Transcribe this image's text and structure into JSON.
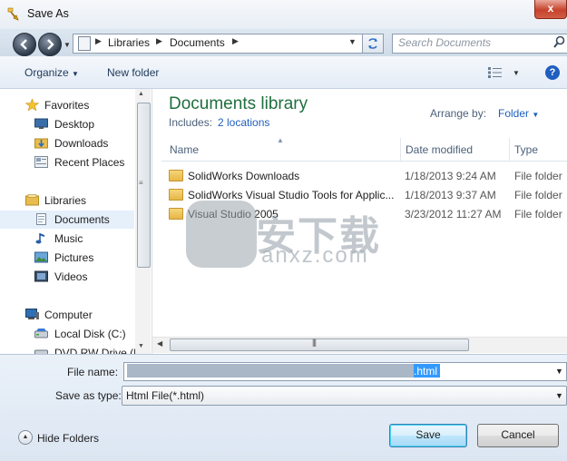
{
  "window": {
    "title": "Save As",
    "close_label": "x"
  },
  "address": {
    "crumbs": [
      "Libraries",
      "Documents"
    ],
    "search_placeholder": "Search Documents"
  },
  "toolbar": {
    "organize": "Organize",
    "new_folder": "New folder"
  },
  "nav": {
    "favorites": "Favorites",
    "desktop": "Desktop",
    "downloads": "Downloads",
    "recent": "Recent Places",
    "libraries": "Libraries",
    "documents": "Documents",
    "music": "Music",
    "pictures": "Pictures",
    "videos": "Videos",
    "computer": "Computer",
    "local_disk": "Local Disk (C:)",
    "dvd": "DVD RW Drive (D"
  },
  "library": {
    "title": "Documents library",
    "includes_label": "Includes:",
    "includes_link": "2 locations",
    "arrange_label": "Arrange by:",
    "arrange_value": "Folder"
  },
  "columns": {
    "name": "Name",
    "date": "Date modified",
    "type": "Type"
  },
  "files": [
    {
      "name": "SolidWorks Downloads",
      "date": "1/18/2013 9:24 AM",
      "type": "File folder"
    },
    {
      "name": "SolidWorks Visual Studio Tools for Applic...",
      "date": "1/18/2013 9:37 AM",
      "type": "File folder"
    },
    {
      "name": "Visual Studio 2005",
      "date": "3/23/2012 11:27 AM",
      "type": "File folder"
    }
  ],
  "form": {
    "file_name_label": "File name:",
    "file_name_value": ".html",
    "save_type_label": "Save as type:",
    "save_type_value": "Html File(*.html)"
  },
  "buttons": {
    "hide_folders": "Hide Folders",
    "save": "Save",
    "cancel": "Cancel"
  },
  "watermark": {
    "text": "安下载",
    "sub": "anxz.com"
  },
  "colors": {
    "accent": "#1f5fbf",
    "title_green": "#1f6f3f",
    "close_red": "#c7432d"
  }
}
